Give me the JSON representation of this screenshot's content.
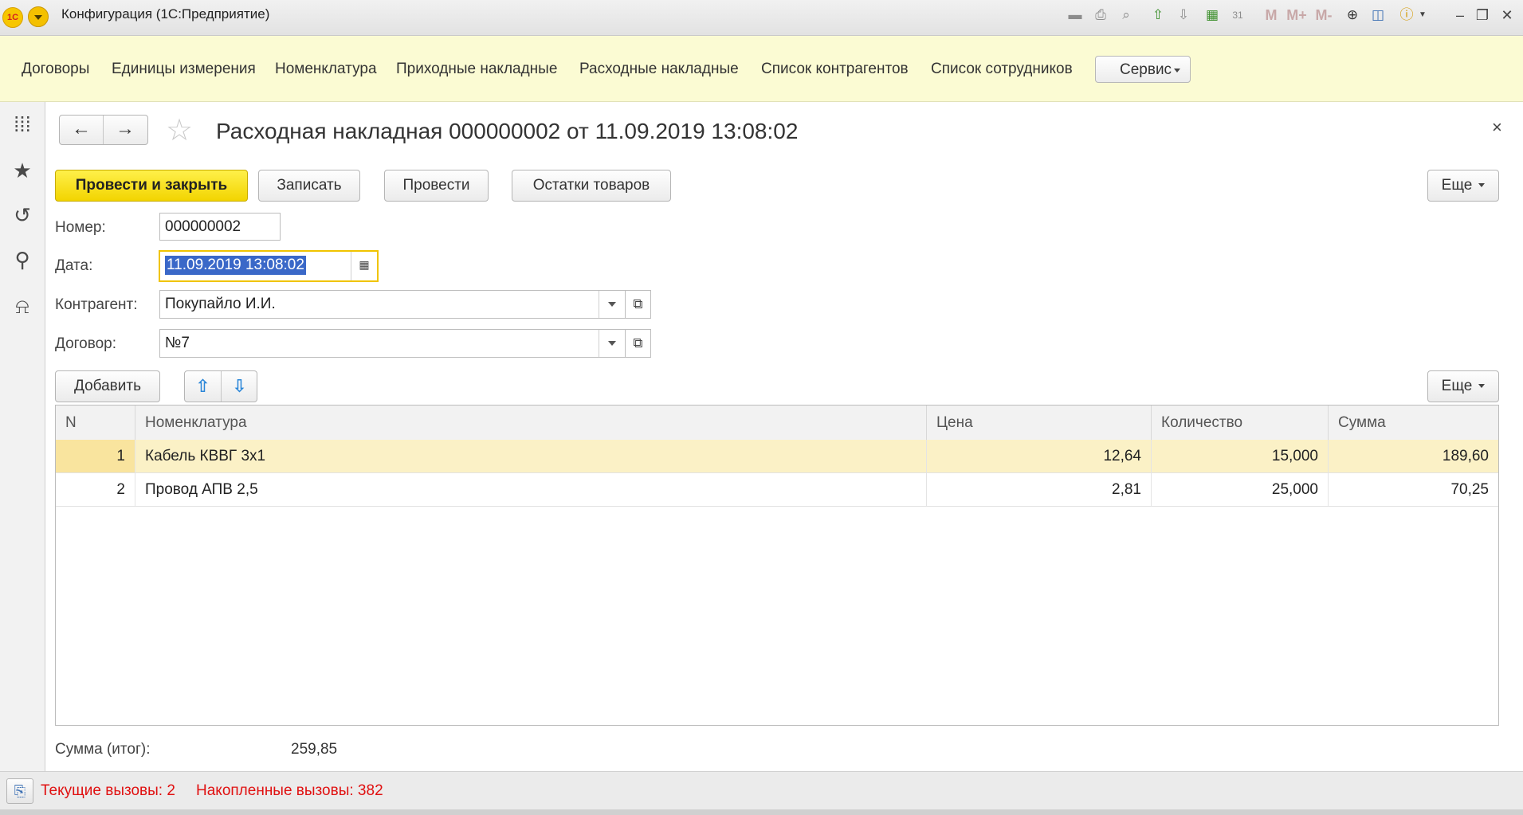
{
  "window": {
    "title": "Конфигурация  (1С:Предприятие)",
    "logo_text": "1С"
  },
  "toolbar": {
    "icons": [
      "save-icon",
      "print-icon",
      "preview-icon",
      "upload-icon",
      "download-icon",
      "calculator-icon",
      "calendar-icon",
      "memory-m-icon",
      "memory-m-plus-icon",
      "memory-m-minus-icon",
      "zoom-icon",
      "panels-icon",
      "info-icon"
    ],
    "m_label": "M",
    "m_plus_label": "M+",
    "m_minus_label": "M-",
    "calendar_label": "31"
  },
  "sections": {
    "items": [
      "Договоры",
      "Единицы измерения",
      "Номенклатура",
      "Приходные накладные",
      "Расходные накладные",
      "Список контрагентов",
      "Список сотрудников"
    ],
    "service_label": "Сервис"
  },
  "left_panel": {
    "icons": [
      "apps-grid-icon",
      "favorites-star-icon",
      "history-icon",
      "search-icon",
      "notifications-bell-icon"
    ]
  },
  "form": {
    "title": "Расходная накладная 000000002 от 11.09.2019 13:08:02",
    "close_glyph": "×",
    "buttons": {
      "post_and_close": "Провести и закрыть",
      "save": "Записать",
      "post": "Провести",
      "stock": "Остатки товаров",
      "more": "Еще"
    },
    "fields": {
      "number_label": "Номер:",
      "number_value": "000000002",
      "date_label": "Дата:",
      "date_value": "11.09.2019 13:08:02",
      "counterparty_label": "Контрагент:",
      "counterparty_value": "Покупайло И.И.",
      "contract_label": "Договор:",
      "contract_value": "№7"
    },
    "table_toolbar": {
      "add": "Добавить",
      "more": "Еще"
    },
    "table": {
      "columns": [
        "N",
        "Номенклатура",
        "Цена",
        "Количество",
        "Сумма"
      ],
      "rows": [
        {
          "n": "1",
          "item": "Кабель КВВГ 3x1",
          "price": "12,64",
          "qty": "15,000",
          "sum": "189,60"
        },
        {
          "n": "2",
          "item": "Провод АПВ 2,5",
          "price": "2,81",
          "qty": "25,000",
          "sum": "70,25"
        }
      ]
    },
    "total_label": "Сумма (итог):",
    "total_value": "259,85"
  },
  "status": {
    "current_calls": "Текущие вызовы: 2",
    "accumulated_calls": "Накопленные вызовы: 382"
  },
  "colors": {
    "accent_yellow": "#f2d400",
    "sections_bg": "#fbfbd3",
    "selection_blue": "#3a68c8",
    "status_red": "#e01010",
    "row_selected": "#fbf1c6"
  }
}
